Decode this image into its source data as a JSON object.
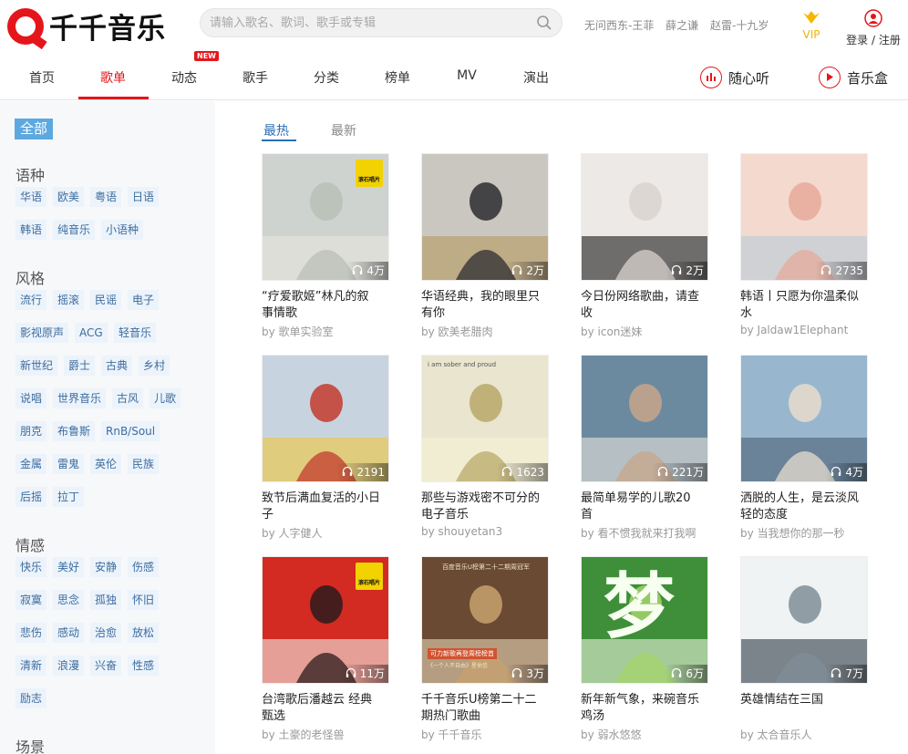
{
  "header": {
    "logo_text": "千千音乐",
    "search_placeholder": "请输入歌名、歌词、歌手或专辑",
    "hot_words": [
      "无问西东-王菲",
      "薛之谦",
      "赵雷-十九岁"
    ],
    "vip_label": "VIP",
    "login_label": "登录 / 注册",
    "brand_color": "#e5161b"
  },
  "nav": {
    "items": [
      "首页",
      "歌单",
      "动态",
      "歌手",
      "分类",
      "榜单",
      "MV",
      "演出"
    ],
    "active_index": 1,
    "new_badge": "NEW",
    "radio_label": "随心听",
    "box_label": "音乐盒"
  },
  "sidebar": {
    "all_label": "全部",
    "categories": [
      {
        "title": "语种",
        "tags": [
          "华语",
          "欧美",
          "粤语",
          "日语",
          "韩语",
          "纯音乐",
          "小语种"
        ]
      },
      {
        "title": "风格",
        "tags": [
          "流行",
          "摇滚",
          "民谣",
          "电子",
          "影视原声",
          "ACG",
          "轻音乐",
          "新世纪",
          "爵士",
          "古典",
          "乡村",
          "说唱",
          "世界音乐",
          "古风",
          "儿歌",
          "朋克",
          "布鲁斯",
          "RnB/Soul",
          "金属",
          "雷鬼",
          "英伦",
          "民族",
          "后摇",
          "拉丁"
        ]
      },
      {
        "title": "情感",
        "tags": [
          "快乐",
          "美好",
          "安静",
          "伤感",
          "寂寞",
          "思念",
          "孤独",
          "怀旧",
          "悲伤",
          "感动",
          "治愈",
          "放松",
          "清新",
          "浪漫",
          "兴奋",
          "性感",
          "励志"
        ]
      },
      {
        "title": "场景",
        "tags": []
      }
    ]
  },
  "main": {
    "tabs": [
      "最热",
      "最新"
    ],
    "playlists": [
      {
        "title_lines": [
          "“疗爱歌姬”林凡的叙",
          "事情歌"
        ],
        "by": "by 歌单实验室",
        "plays": "4万",
        "badge": "滚石唱片"
      },
      {
        "title_lines": [
          "华语经典，我的眼里只",
          "有你"
        ],
        "by": "by 欧美老腊肉",
        "plays": "2万"
      },
      {
        "title_lines": [
          "今日份网络歌曲，请查",
          "收"
        ],
        "by": "by icon迷妹",
        "plays": "2万"
      },
      {
        "title_lines": [
          "韩语丨只愿为你温柔似",
          "水"
        ],
        "by": "by Jaldaw1Elephant",
        "plays": "2735"
      },
      {
        "title_lines": [
          "致节后满血复活的小日",
          "子"
        ],
        "by": "by 人字健人",
        "plays": "2191"
      },
      {
        "title_lines": [
          "那些与游戏密不可分的",
          "电子音乐"
        ],
        "by": "by shouyetan3",
        "plays": "1623",
        "caption": "i am sober and proud"
      },
      {
        "title_lines": [
          "最简单易学的儿歌20",
          "首"
        ],
        "by": "by 看不惯我就来打我啊",
        "plays": "221万"
      },
      {
        "title_lines": [
          "洒脱的人生，是云淡风",
          "轻的态度"
        ],
        "by": "by 当我想你的那一秒",
        "plays": "4万"
      },
      {
        "title_lines": [
          "台湾歌后潘越云 经典",
          "甄选"
        ],
        "by": "by 土豪的老怪兽",
        "plays": "11万",
        "badge": "滚石唱片"
      },
      {
        "title_lines": [
          "千千音乐U榜第二十二",
          "期热门歌曲"
        ],
        "by": "by 千千音乐",
        "plays": "3万",
        "poster_top": "百度音乐U榜第二十二期周冠军",
        "poster_bottom": "可力新歌再登周榜榜首",
        "poster_small": "《一个人不自由》星佑信"
      },
      {
        "title_lines": [
          "新年新气象，来碗音乐",
          "鸡汤"
        ],
        "by": "by 弱水悠悠",
        "plays": "6万",
        "poster_char": "梦"
      },
      {
        "title_lines": [
          "英雄情结在三国",
          ""
        ],
        "by": "by 太合音乐人",
        "plays": "7万"
      }
    ]
  }
}
